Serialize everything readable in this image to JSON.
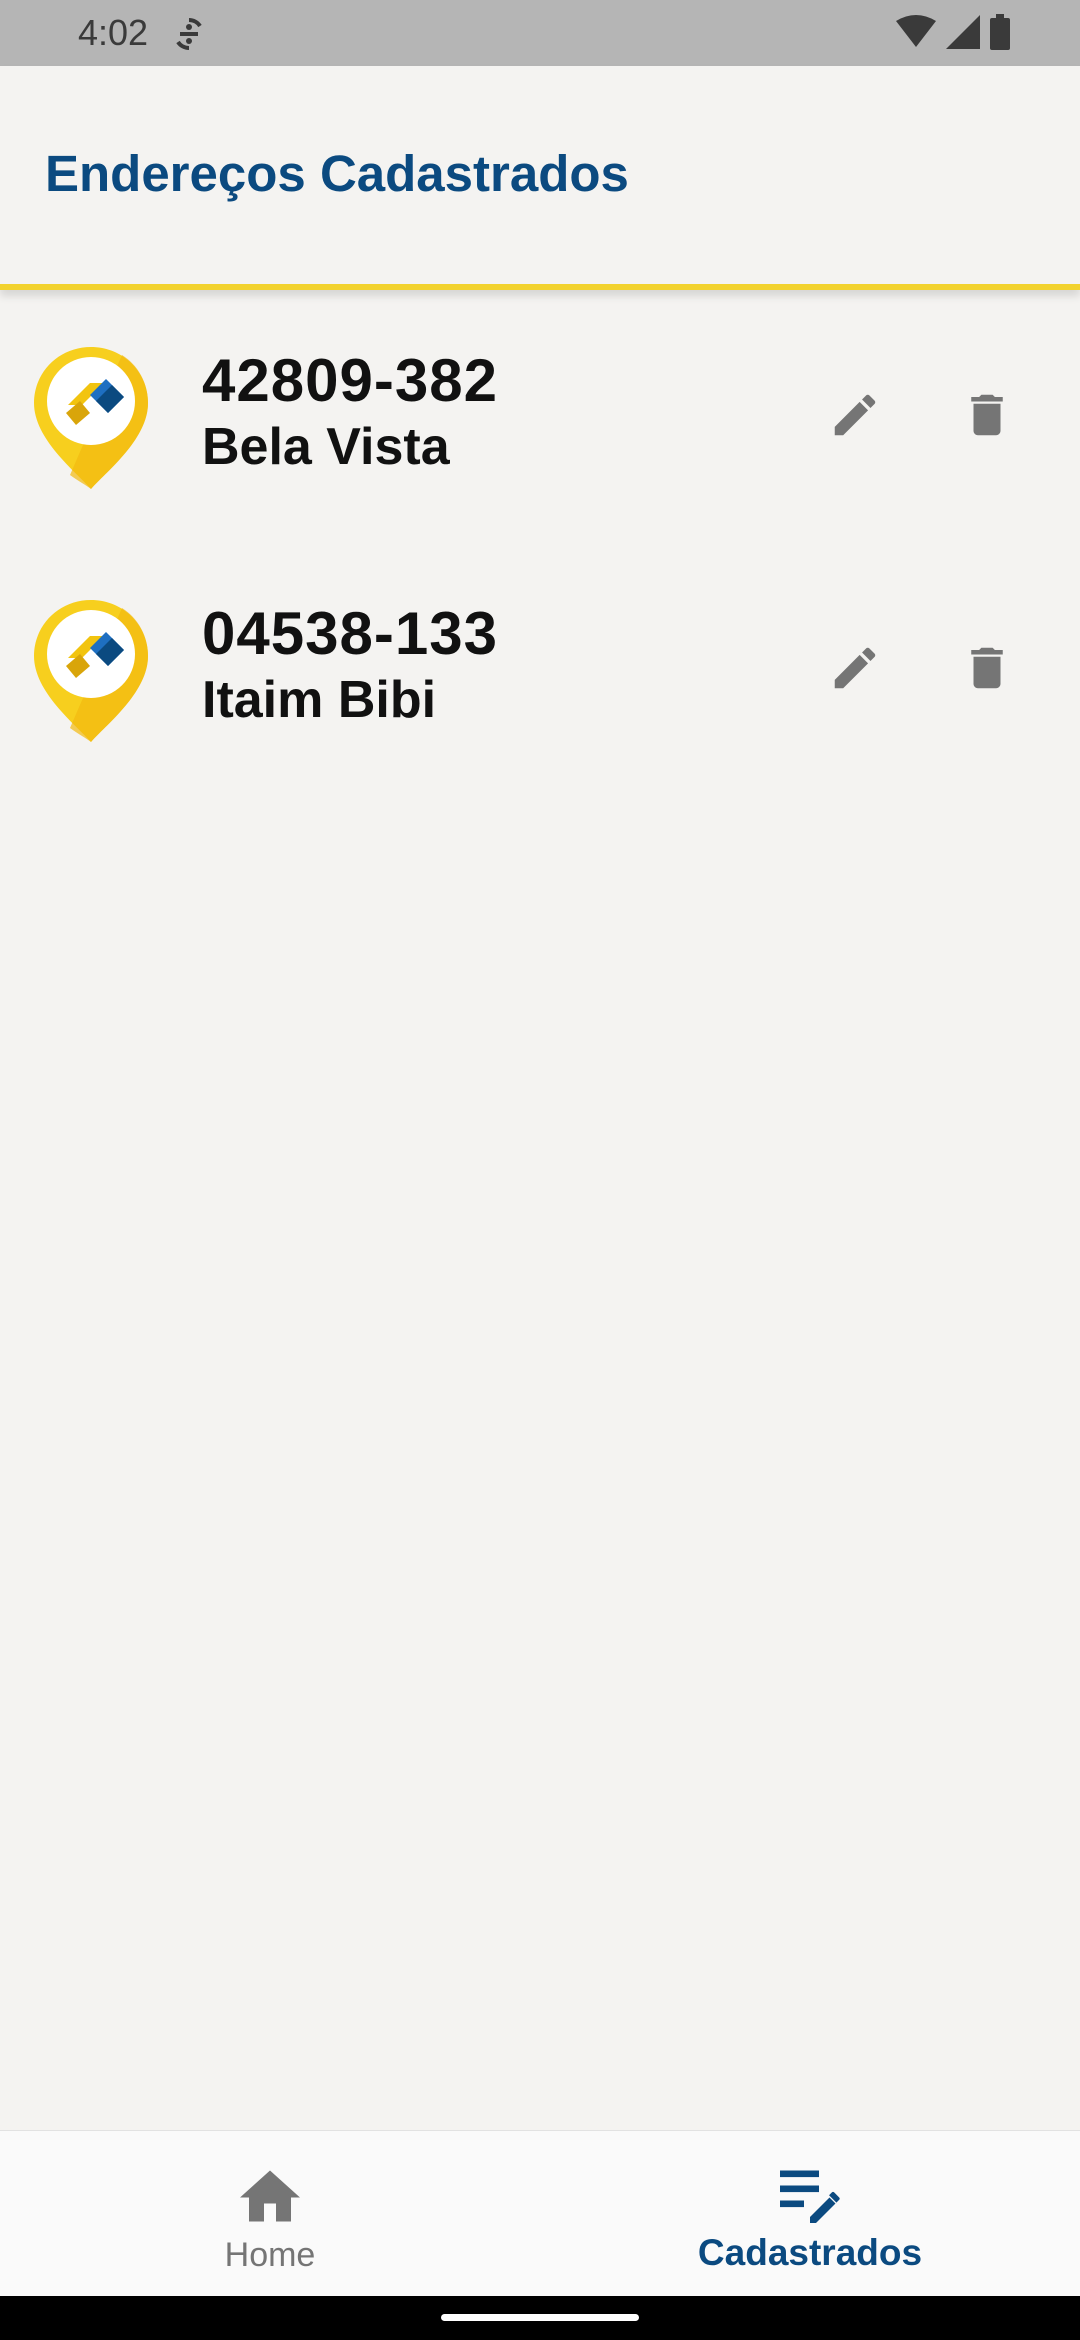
{
  "status_bar": {
    "time": "4:02",
    "left_icon": "sync-icon",
    "right_icons": [
      "wifi-icon",
      "signal-icon",
      "battery-icon"
    ]
  },
  "app_bar": {
    "title": "Endereços Cadastrados"
  },
  "addresses": [
    {
      "cep": "42809-382",
      "district": "Bela Vista"
    },
    {
      "cep": "04538-133",
      "district": "Itaim Bibi"
    }
  ],
  "item_actions": {
    "edit_icon": "pencil-icon",
    "delete_icon": "trash-icon"
  },
  "bottom_nav": {
    "items": [
      {
        "label": "Home",
        "icon": "home-icon",
        "active": false
      },
      {
        "label": "Cadastrados",
        "icon": "list-edit-icon",
        "active": true
      }
    ]
  },
  "colors": {
    "brand_blue": "#0b4a80",
    "accent_yellow": "#f2d22e",
    "background": "#f4f3f1",
    "icon_gray": "#757575"
  }
}
